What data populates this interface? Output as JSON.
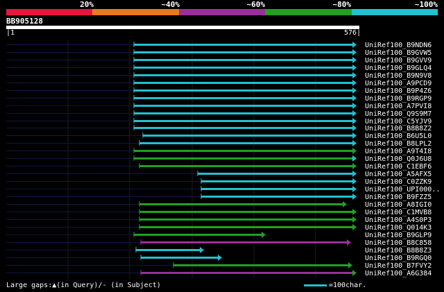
{
  "scale": {
    "labels": [
      "20%",
      "~40%",
      "~60%",
      "~80%",
      "~100%"
    ],
    "colors": [
      "#e8153c",
      "#ea7a1b",
      "#9b2f9a",
      "#22a022",
      "#22c1cf"
    ]
  },
  "query": {
    "name": "BB905128",
    "start": "1",
    "end": "576"
  },
  "hits": [
    {
      "name": "UniRef100_B9NDN6",
      "start": 193,
      "end": 514,
      "color": "#22c1cf",
      "arrow": "#22c1cf"
    },
    {
      "name": "UniRef100_B9GVW5",
      "start": 193,
      "end": 514,
      "color": "#22c1cf",
      "arrow": "#22c1cf"
    },
    {
      "name": "UniRef100_B9GVV9",
      "start": 193,
      "end": 514,
      "color": "#22c1cf",
      "arrow": "#22c1cf"
    },
    {
      "name": "UniRef100_B9GLQ4",
      "start": 193,
      "end": 514,
      "color": "#22c1cf",
      "arrow": "#22c1cf"
    },
    {
      "name": "UniRef100_B9N9V8",
      "start": 193,
      "end": 514,
      "color": "#22c1cf",
      "arrow": "#22c1cf"
    },
    {
      "name": "UniRef100_A9PCD9",
      "start": 193,
      "end": 514,
      "color": "#22c1cf",
      "arrow": "#22c1cf"
    },
    {
      "name": "UniRef100_B9P4Z6",
      "start": 193,
      "end": 514,
      "color": "#22c1cf",
      "arrow": "#22c1cf"
    },
    {
      "name": "UniRef100_B9RGP9",
      "start": 193,
      "end": 514,
      "color": "#22c1cf",
      "arrow": "#22c1cf"
    },
    {
      "name": "UniRef100_A7PVI8",
      "start": 193,
      "end": 514,
      "color": "#22c1cf",
      "arrow": "#22c1cf"
    },
    {
      "name": "UniRef100_Q9S9M7",
      "start": 193,
      "end": 514,
      "color": "#22c1cf",
      "arrow": "#22c1cf"
    },
    {
      "name": "UniRef100_C5YJV9",
      "start": 193,
      "end": 514,
      "color": "#22c1cf",
      "arrow": "#22c1cf"
    },
    {
      "name": "UniRef100_B8B8Z2",
      "start": 193,
      "end": 514,
      "color": "#22c1cf",
      "arrow": "#22c1cf"
    },
    {
      "name": "UniRef100_B6U5L0",
      "start": 206,
      "end": 514,
      "color": "#22c1cf",
      "arrow": "#22c1cf"
    },
    {
      "name": "UniRef100_B8LPL2",
      "start": 201,
      "end": 514,
      "color": "#22c1cf",
      "arrow": "#22c1cf"
    },
    {
      "name": "UniRef100_A9T4I8",
      "start": 193,
      "end": 514,
      "color": "#22a022",
      "arrow": "#22a022"
    },
    {
      "name": "UniRef100_Q0J6U8",
      "start": 193,
      "end": 514,
      "color": "#22a022",
      "arrow": "#22c1cf"
    },
    {
      "name": "UniRef100_C1EBF6",
      "start": 201,
      "end": 514,
      "color": "#22a022",
      "arrow": "#22a022"
    },
    {
      "name": "UniRef100_A5AFX5",
      "start": 285,
      "end": 514,
      "color": "#22c1cf",
      "arrow": "#22c1cf"
    },
    {
      "name": "UniRef100_C0ZZK9",
      "start": 290,
      "end": 514,
      "color": "#22c1cf",
      "arrow": "#22c1cf"
    },
    {
      "name": "UniRef100_UPI000..",
      "start": 290,
      "end": 514,
      "color": "#22c1cf",
      "arrow": "#22c1cf"
    },
    {
      "name": "UniRef100_B9FZZ5",
      "start": 290,
      "end": 514,
      "color": "#22c1cf",
      "arrow": "#22c1cf"
    },
    {
      "name": "UniRef100_A8IGI0",
      "start": 201,
      "end": 500,
      "color": "#22a022",
      "arrow": "#22a022"
    },
    {
      "name": "UniRef100_C1MVB8",
      "start": 201,
      "end": 514,
      "color": "#22a022",
      "arrow": "#22a022"
    },
    {
      "name": "UniRef100_A4S0P3",
      "start": 201,
      "end": 514,
      "color": "#22a022",
      "arrow": "#22a022"
    },
    {
      "name": "UniRef100_Q014K3",
      "start": 201,
      "end": 514,
      "color": "#22a022",
      "arrow": "#22a022"
    },
    {
      "name": "UniRef100_B9GLP9",
      "start": 193,
      "end": 383,
      "color": "#22a022",
      "arrow": "#22a022"
    },
    {
      "name": "UniRef100_B8C858",
      "start": 203,
      "end": 506,
      "color": "#9b2f9a",
      "arrow": "#9b2f9a"
    },
    {
      "name": "UniRef100_B8B8Z3",
      "start": 196,
      "end": 294,
      "color": "#22c1cf",
      "arrow": "#22c1cf"
    },
    {
      "name": "UniRef100_B9RGQ0",
      "start": 203,
      "end": 320,
      "color": "#22c1cf",
      "arrow": "#22c1cf"
    },
    {
      "name": "UniRef100_B7FVY2",
      "start": 250,
      "end": 508,
      "color": "#22a022",
      "arrow": "#22a022"
    },
    {
      "name": "UniRef100_A6G384",
      "start": 203,
      "end": 514,
      "color": "#9b2f9a",
      "arrow": "#22a022"
    }
  ],
  "legend": {
    "gaps_text": "Large gaps:▲(in Query)/- (in Subject)",
    "key_text": "=100char."
  }
}
